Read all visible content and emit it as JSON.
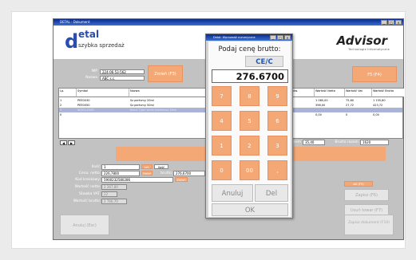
{
  "window": {
    "title": "DETAL - Dokument"
  },
  "logo": {
    "d": "d",
    "etal": "etal",
    "sub": "szybka sprzedaż"
  },
  "advisor": {
    "name": "Advisor",
    "sub": "Technologie Informatyczne"
  },
  "customer": {
    "nip_label": "NIP",
    "nip_value": "224-06-53-562",
    "nazwa_label": "Nazwa",
    "nazwa_value": "ABC s.c.",
    "zmien_label": "Zmień (F3)"
  },
  "f5_label": "F5 (F4)",
  "grid": {
    "headers": [
      "Lp.",
      "Symbol",
      "Nazwa",
      "Ilość / Zamów.",
      "Wartość Netto",
      "Wartość Vat",
      "Wartość Brutto"
    ],
    "rows": [
      [
        "1",
        "PEE0030",
        "Sz perfumy 20ml",
        "1,0000",
        "1 080,00",
        "75,60",
        "1 155,60"
      ],
      [
        "2",
        "PEE0050",
        "Sz perfumy 50ml",
        "6,0000",
        "396,00",
        "27,72",
        "423,72"
      ],
      [
        "3",
        "WOD-LIGER",
        "Black Tiger woda toaletowa 50ml",
        "1,0000",
        "",
        "",
        ""
      ],
      [
        "0",
        "",
        "",
        "",
        "0,00",
        "0",
        "0,00"
      ]
    ]
  },
  "grid_counter": "1",
  "totals": {
    "razem_label": "Razem",
    "razem_value": "35,40",
    "brutto_label": "Brutto razem",
    "brutto_value": "1620"
  },
  "product_desc": "Black Tiger woda toaletowa 50ml",
  "form": {
    "ilosc_label": "Ilość",
    "ilosc_value": "1",
    "cena_netto_label": "Cena. netto",
    "cena_netto_value": "226,7800",
    "brutto_label": "brutto",
    "brutto_value": "276,6700",
    "kod_label": "Kod kreskowy",
    "kod_value": "5900232580286",
    "wartosc_netto_label": "Wartość netto",
    "wartosc_netto_value": "2 267,80",
    "stawka_label": "Stawka VAT",
    "stawka_value": "22",
    "wartosc_brutto_label": "Wartość brutto",
    "wartosc_brutto_value": "2 766,70",
    "zmien_label": "Zmień",
    "szt_label": "szt.",
    "ilosc_btn_label": "Ilość"
  },
  "right_buttons": {
    "extra": "wit (F5)",
    "zapisz": "Zapisz (F6)",
    "usun": "Usuń towar (F7)"
  },
  "bottom": {
    "anuluj": "Anuluj (Esc)",
    "zapisz_dok": "Zapisz dokument (F10)"
  },
  "dialog": {
    "title": "Detal: Wprowadź numeryczne",
    "prompt": "Podaj cenę brutto:",
    "cec": "CE/C",
    "display": "276.6700",
    "keys": [
      "7",
      "8",
      "9",
      "4",
      "5",
      "6",
      "1",
      "2",
      "3",
      "0",
      "00",
      ","
    ],
    "anuluj": "Anuluj",
    "del": "Del",
    "ok": "OK"
  },
  "colors": {
    "accent": "#f4a876",
    "brand_blue": "#2a4db0"
  }
}
